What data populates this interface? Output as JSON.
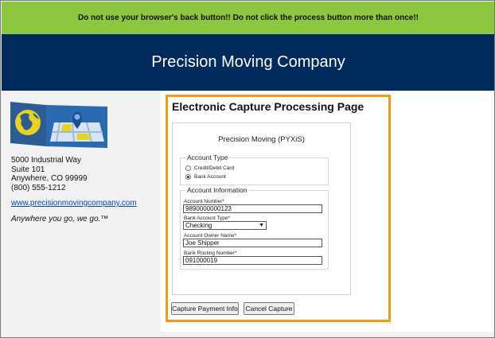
{
  "warning": {
    "text": "Do not use your browser's back button!! Do not click the process button more than once!!"
  },
  "header": {
    "title": "Precision Moving Company"
  },
  "sidebar": {
    "address_lines": [
      "5000 Industrial Way",
      "Suite 101",
      "Anywhere, CO 99999",
      "(800) 555-1212"
    ],
    "website": "www.precisionmovingcompany.com",
    "tagline": "Anywhere you go, we go.™"
  },
  "main": {
    "page_title": "Electronic Capture Processing Page",
    "form": {
      "title": "Precision Moving (PYXiS)",
      "account_type": {
        "legend": "Account Type",
        "options": [
          {
            "label": "Credit/Debit Card",
            "selected": false
          },
          {
            "label": "Bank Account",
            "selected": true
          }
        ]
      },
      "account_info": {
        "legend": "Account Information",
        "account_number_label": "Account Number*",
        "account_number_value": "9890000000123",
        "bank_account_type_label": "Bank Account Type*",
        "bank_account_type_value": "Checking",
        "owner_name_label": "Account Owner Name*",
        "owner_name_value": "Joe Shipper",
        "routing_number_label": "Bank Routing Number*",
        "routing_number_value": "091000019"
      }
    },
    "buttons": {
      "capture_label": "Capture Payment Info",
      "cancel_label": "Cancel Capture"
    }
  },
  "colors": {
    "warning_bg": "#8dc63f",
    "header_bg": "#002b5c",
    "highlight_border": "#f39c12",
    "link": "#0645ad"
  }
}
